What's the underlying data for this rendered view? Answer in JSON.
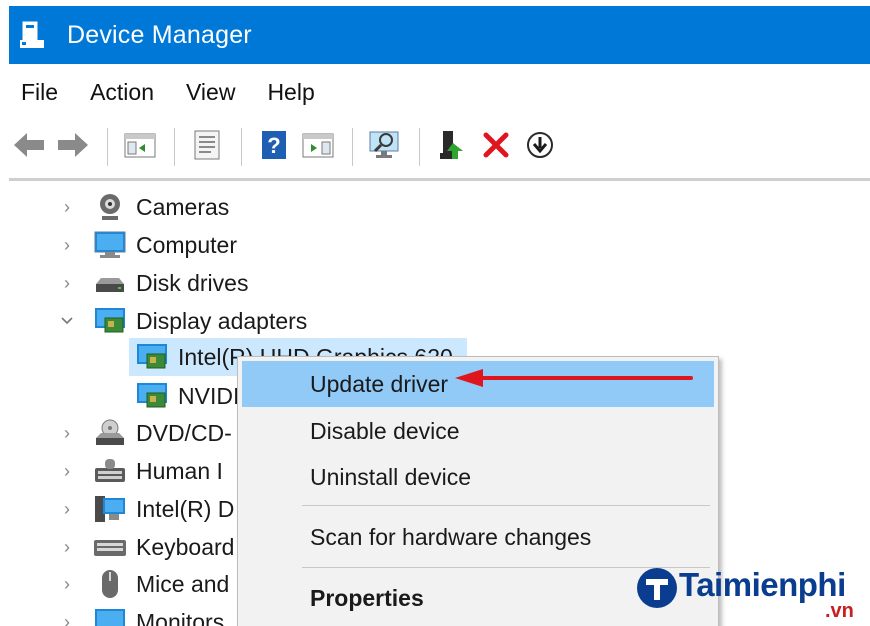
{
  "window": {
    "title": "Device Manager"
  },
  "menu": [
    "File",
    "Action",
    "View",
    "Help"
  ],
  "toolbar": {
    "buttons": [
      "back-arrow-icon",
      "forward-arrow-icon",
      "console-tree-icon",
      "properties-sheet-icon",
      "help-icon",
      "action-pane-icon",
      "scan-hardware-icon",
      "update-driver-icon",
      "uninstall-icon",
      "download-icon"
    ]
  },
  "tree": {
    "items": [
      {
        "label": "Cameras",
        "icon": "camera-icon",
        "expanded": false
      },
      {
        "label": "Computer",
        "icon": "computer-icon",
        "expanded": false
      },
      {
        "label": "Disk drives",
        "icon": "disk-drive-icon",
        "expanded": false
      },
      {
        "label": "Display adapters",
        "icon": "display-adapter-icon",
        "expanded": true
      },
      {
        "label": "Intel(R) UHD Graphics 620",
        "icon": "display-adapter-icon",
        "child": true,
        "selected": true
      },
      {
        "label": "NVIDIA",
        "icon": "display-adapter-icon",
        "child": true
      },
      {
        "label": "DVD/CD-",
        "icon": "dvd-drive-icon",
        "expanded": false
      },
      {
        "label": "Human I",
        "icon": "hid-icon",
        "expanded": false
      },
      {
        "label": "Intel(R) D",
        "icon": "intel-device-icon",
        "expanded": false
      },
      {
        "label": "Keyboard",
        "icon": "keyboard-icon",
        "expanded": false
      },
      {
        "label": "Mice and",
        "icon": "mouse-icon",
        "expanded": false
      },
      {
        "label": "Monitors",
        "icon": "monitor-icon",
        "expanded": false
      }
    ]
  },
  "context_menu": {
    "items": [
      "Update driver",
      "Disable device",
      "Uninstall device",
      "Scan for hardware changes",
      "Properties"
    ],
    "highlighted": "Update driver",
    "bold": "Properties"
  },
  "watermark": {
    "text": "Taimienphi",
    "sub": ".vn"
  },
  "colors": {
    "titlebar": "#0078d7",
    "selection": "#cce8ff",
    "menu_highlight": "#91c9f7",
    "arrow": "#e0161e"
  }
}
